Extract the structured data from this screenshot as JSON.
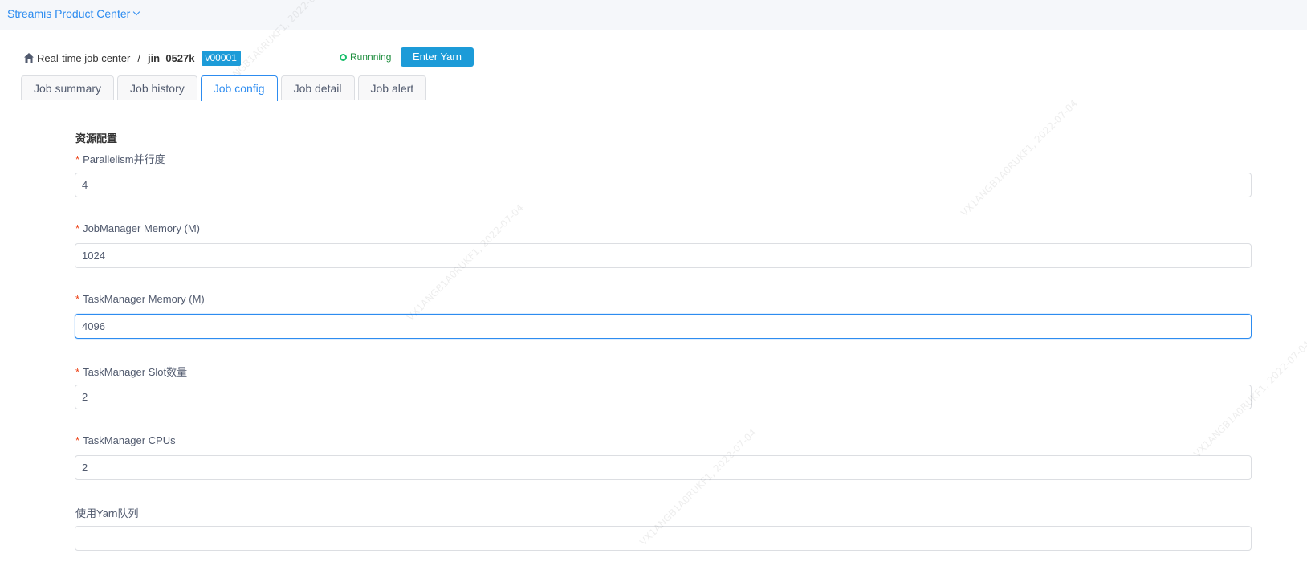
{
  "topbar": {
    "product": "Streamis Product Center"
  },
  "breadcrumb": {
    "root": "Real-time job center",
    "separator": "/",
    "job_name": "jin_0527k",
    "version": "v00001"
  },
  "status": {
    "text": "Runnning",
    "color": "#19be6b"
  },
  "yarn_button": "Enter Yarn",
  "tabs": [
    {
      "label": "Job summary"
    },
    {
      "label": "Job history"
    },
    {
      "label": "Job config",
      "active": true
    },
    {
      "label": "Job detail"
    },
    {
      "label": "Job alert"
    }
  ],
  "section": {
    "title": "资源配置"
  },
  "fields": [
    {
      "label": "Parallelism并行度",
      "required": true,
      "value": "4"
    },
    {
      "label": "JobManager Memory (M)",
      "required": true,
      "value": "1024"
    },
    {
      "label": "TaskManager Memory (M)",
      "required": true,
      "value": "4096",
      "focused": true
    },
    {
      "label": "TaskManager Slot数量",
      "required": true,
      "value": "2"
    },
    {
      "label": "TaskManager CPUs",
      "required": true,
      "value": "2"
    },
    {
      "label": "使用Yarn队列",
      "required": false,
      "value": ""
    }
  ],
  "watermark": "VX1ANGB1A0RUKF1, 2022-07-04",
  "colors": {
    "accent": "#2d8cf0",
    "button": "#1c9bd8",
    "required": "#ed4014"
  }
}
